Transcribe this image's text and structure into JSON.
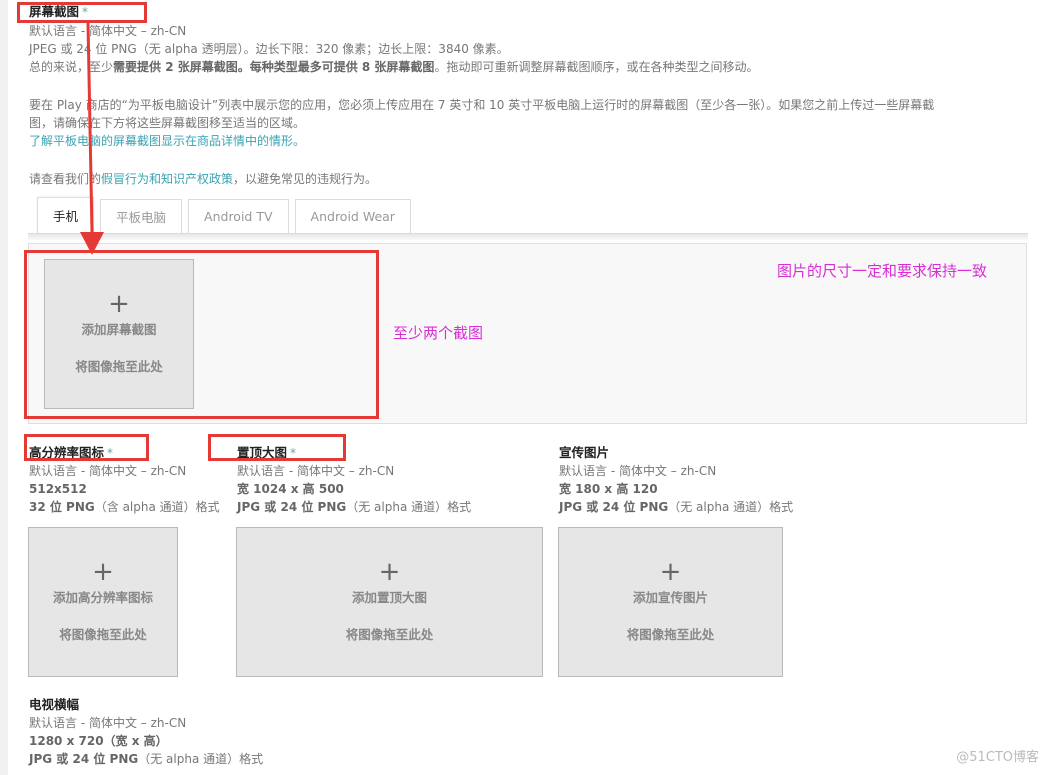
{
  "screenshots": {
    "title": "屏幕截图",
    "required_mark": "*",
    "lang": "默认语言 - 简体中文 – zh-CN",
    "format": "JPEG 或 24 位 PNG（无 alpha 透明层）。边长下限：320 像素；边长上限：3840 像素。",
    "summary_pre": "总的来说，至少",
    "summary_bold1": "需要提供 2 张屏幕截图。每种类型最多可提供 8 张屏幕截图",
    "summary_post": "。拖动即可重新调整屏幕截图顺序，或在各种类型之间移动。",
    "tablet_note_line1": "要在 Play 商店的“为平板电脑设计”列表中展示您的应用，您必须上传应用在 7 英寸和 10 英寸平板电脑上运行时的屏幕截图（至少各一张）。如果您之前上传过一些屏幕截",
    "tablet_note_line2": "图，请确保在下方将这些屏幕截图移至适当的区域。",
    "tablet_link": "了解平板电脑的屏幕截图显示在商品详情中的情形。",
    "policy_pre": "请查看我们的",
    "policy_link": "假冒行为和知识产权政策",
    "policy_post": "，以避免常见的违规行为。",
    "tabs": [
      {
        "label": "手机",
        "active": true
      },
      {
        "label": "平板电脑",
        "active": false
      },
      {
        "label": "Android TV",
        "active": false
      },
      {
        "label": "Android Wear",
        "active": false
      }
    ],
    "dropzone": {
      "plus": "+",
      "add": "添加屏幕截图",
      "drag": "将图像拖至此处"
    }
  },
  "annotations": {
    "min_two": "至少两个截图",
    "size_match": "图片的尺寸一定和要求保持一致",
    "highlight_color": "#e53935",
    "note_color": "#d92ed5"
  },
  "assets": [
    {
      "title": "高分辨率图标",
      "required": "*",
      "lang": "默认语言 - 简体中文 – zh-CN",
      "size": "512x512",
      "format_bold": "32 位 PNG",
      "format_rest": "（含 alpha 通道）格式",
      "add": "添加高分辨率图标",
      "drag": "将图像拖至此处"
    },
    {
      "title": "置顶大图",
      "required": "*",
      "lang": "默认语言 - 简体中文 – zh-CN",
      "size": "宽 1024 x 高 500",
      "format_bold": "JPG 或 24 位 PNG",
      "format_rest": "（无 alpha 通道）格式",
      "add": "添加置顶大图",
      "drag": "将图像拖至此处"
    },
    {
      "title": "宣传图片",
      "required": "",
      "lang": "默认语言 - 简体中文 – zh-CN",
      "size": "宽 180 x 高 120",
      "format_bold": "JPG 或 24 位 PNG",
      "format_rest": "（无 alpha 通道）格式",
      "add": "添加宣传图片",
      "drag": "将图像拖至此处"
    },
    {
      "title": "电视横幅",
      "required": "",
      "lang": "默认语言 - 简体中文 – zh-CN",
      "size": "1280 x 720（宽 x 高）",
      "format_bold": "JPG 或 24 位 PNG",
      "format_rest": "（无 alpha 通道）格式"
    }
  ],
  "watermark": "@51CTO博客"
}
